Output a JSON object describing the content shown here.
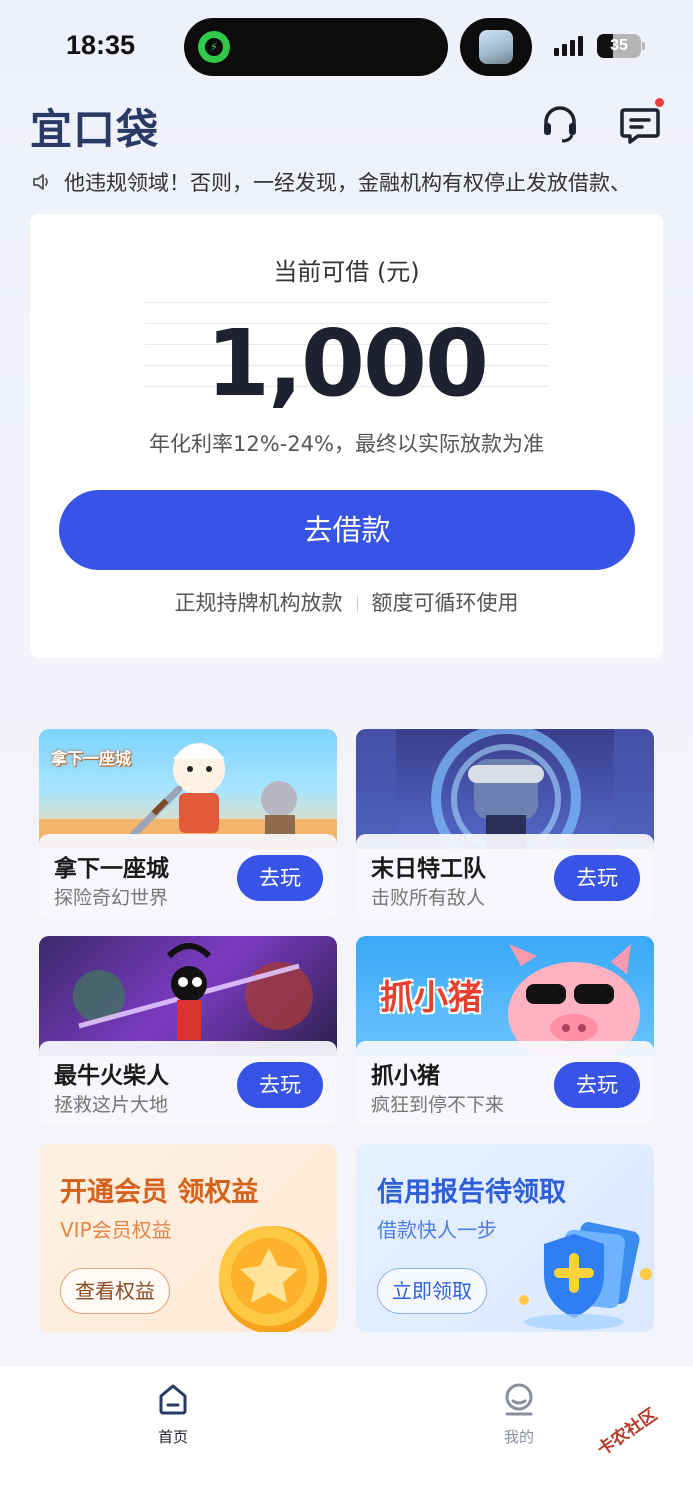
{
  "status_bar": {
    "time": "18:35",
    "battery": "35"
  },
  "header": {
    "logo": "宜口袋",
    "support_icon": "headset-icon",
    "message_icon": "message-icon"
  },
  "notice": {
    "icon": "speaker-icon",
    "text": "他违规领域！否则，一经发现，金融机构有权停止发放借款、"
  },
  "loan": {
    "label": "当前可借 (元)",
    "amount": "1,000",
    "rate": "年化利率12%-24%，最终以实际放款为准",
    "button": "去借款",
    "footer_left": "正规持牌机构放款",
    "footer_right": "额度可循环使用"
  },
  "games": [
    {
      "name": "拿下一座城",
      "sub": "探险奇幻世界",
      "button": "去玩",
      "art_label": "拿下一座城"
    },
    {
      "name": "末日特工队",
      "sub": "击败所有敌人",
      "button": "去玩"
    },
    {
      "name": "最牛火柴人",
      "sub": "拯救这片大地",
      "button": "去玩"
    },
    {
      "name": "抓小猪",
      "sub": "疯狂到停不下来",
      "button": "去玩",
      "art_label": "抓小猪"
    }
  ],
  "promos": [
    {
      "title": "开通会员 领权益",
      "sub": "VIP会员权益",
      "button": "查看权益"
    },
    {
      "title": "信用报告待领取",
      "sub": "借款快人一步",
      "button": "立即领取"
    }
  ],
  "nav": [
    {
      "label": "首页",
      "icon": "home-icon",
      "active": true
    },
    {
      "label": "我的",
      "icon": "profile-icon",
      "active": false
    }
  ],
  "watermark": "卡农社区",
  "colors": {
    "primary": "#3754e6",
    "logo": "#2a3a64",
    "vip": "#d4611c",
    "credit": "#2f5fd8"
  }
}
